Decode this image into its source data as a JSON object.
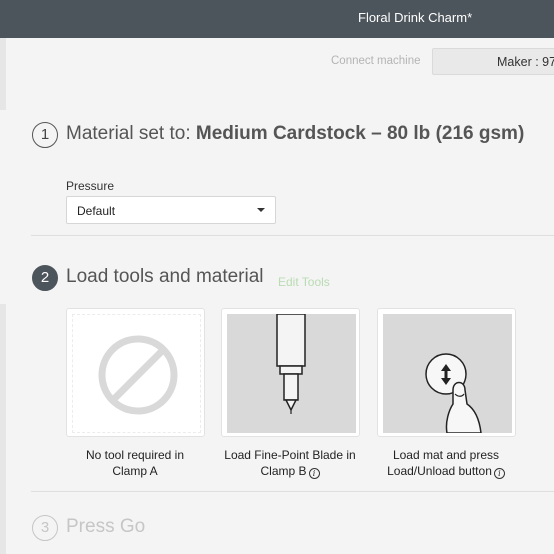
{
  "window": {
    "title": "Floral Drink Charm*"
  },
  "header": {
    "connect_label": "Connect machine",
    "machine_label": "Maker : 97"
  },
  "step1": {
    "number": "1",
    "title_prefix": "Material set to:",
    "material": "Medium Cardstock – 80 lb (216 gsm)",
    "pressure_label": "Pressure",
    "pressure_value": "Default"
  },
  "step2": {
    "number": "2",
    "title": "Load tools and material",
    "edit_tools": "Edit Tools",
    "cards": [
      {
        "line1": "No tool required in",
        "line2": "Clamp A",
        "icon": "no-tool-icon"
      },
      {
        "line1": "Load Fine-Point Blade in",
        "line2": "Clamp B",
        "icon": "fine-point-blade-icon",
        "info": "i"
      },
      {
        "line1": "Load mat and press",
        "line2": "Load/Unload button",
        "icon": "load-unload-button-icon",
        "info": "i"
      }
    ]
  },
  "step3": {
    "number": "3",
    "title": "Press Go"
  },
  "colors": {
    "titlebar": "#4d555c",
    "edit_tools": "#b9dcb2",
    "faded": "#c6c6c6"
  }
}
